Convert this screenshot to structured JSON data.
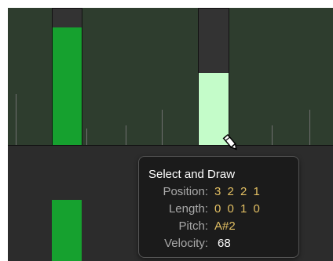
{
  "tooltip": {
    "title": "Select and Draw",
    "rows": [
      {
        "label": "Position:",
        "value": "3 2 2 1"
      },
      {
        "label": "Length:",
        "value": "0 0 1 0"
      },
      {
        "label": "Pitch:",
        "value": "A#2"
      },
      {
        "label": "Velocity:",
        "value": "68"
      }
    ]
  },
  "velocity_bars": [
    {
      "name": "note-1",
      "velocity_fraction": 0.86,
      "color": "#16a12f"
    },
    {
      "name": "note-2-selected",
      "velocity_fraction": 0.53,
      "color": "#c4fcc9"
    }
  ],
  "colors": {
    "lane_background": "#2e3d2e",
    "lower_lane_background": "#2c2c2c",
    "note_green": "#16a12f",
    "selected_note": "#c4fcc9",
    "value_accent": "#e2bf63"
  },
  "cursor": {
    "icon": "pencil-icon"
  }
}
